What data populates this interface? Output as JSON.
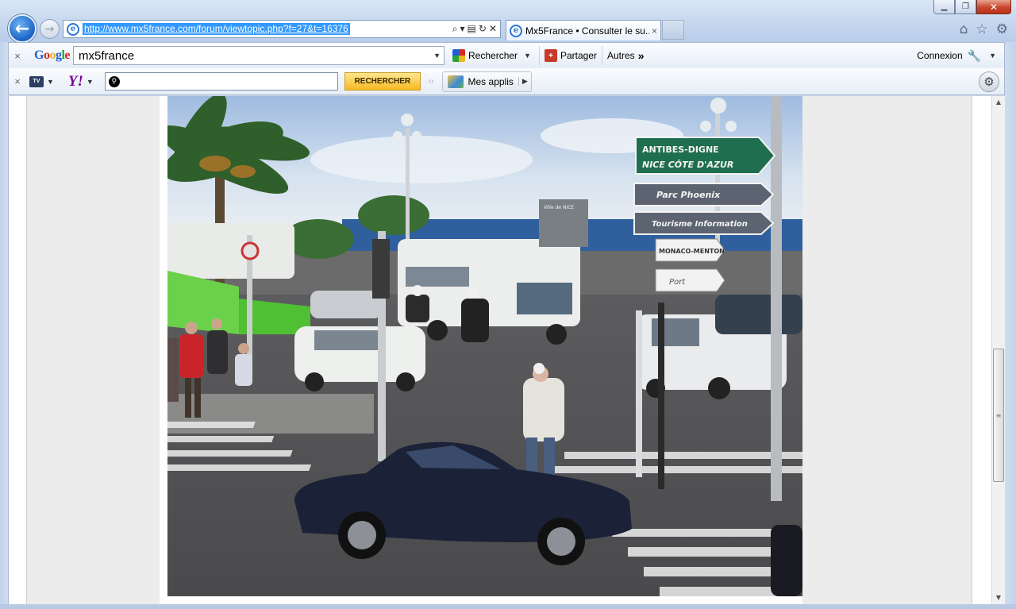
{
  "browser": {
    "address_url": "http://www.mx5france.com/forum/viewtopic.php?f=27&t=16376",
    "tab_title": "Mx5France • Consulter le su...",
    "tab_close": "×",
    "window_close": "✕"
  },
  "google_toolbar": {
    "logo": [
      "G",
      "o",
      "o",
      "g",
      "l",
      "e"
    ],
    "search_value": "mx5france",
    "search_button": "Rechercher",
    "share_button": "Partager",
    "more_button": "Autres",
    "more_glyph": "»",
    "login_label": "Connexion",
    "close_glyph": "×"
  },
  "yahoo_toolbar": {
    "tv_label": "TV",
    "logo": "Y!",
    "search_value": "",
    "search_button": "RECHERCHER",
    "apps_label": "Mes applis",
    "close_glyph": "×"
  },
  "photo": {
    "signs": {
      "antibes": "ANTIBES-DIGNE",
      "nice": "NICE CÔTE D'AZUR",
      "parc": "Parc Phoenix",
      "tourisme": "Tourisme Information",
      "monaco": "MONACO-MENTON",
      "port": "Port",
      "ville": "Ville de NICE"
    }
  },
  "colors": {
    "sign_green": "#1f6e50",
    "sign_grey": "#5b6470",
    "sky": "#bcd2ec",
    "sea": "#2f5f9d",
    "car": "#1b2238"
  }
}
